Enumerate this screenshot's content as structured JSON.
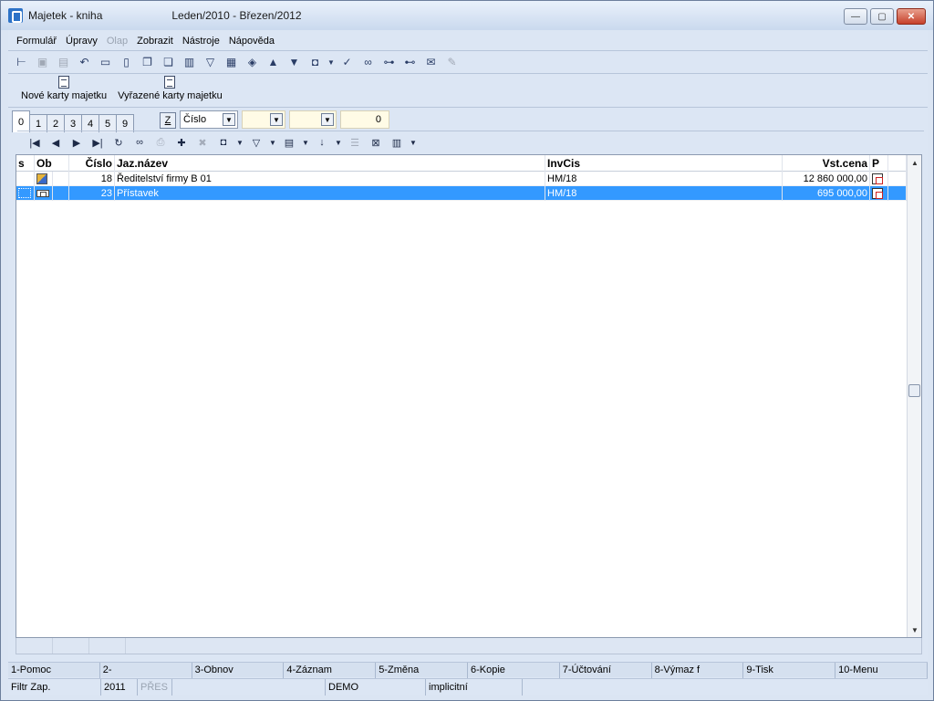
{
  "window": {
    "title": "Majetek - kniha",
    "period": "Leden/2010 - Březen/2012",
    "controls": {
      "minimize": "—",
      "maximize": "▢",
      "close": "✕"
    }
  },
  "menu": [
    "Formulář",
    "Úpravy",
    "Olap",
    "Zobrazit",
    "Nástroje",
    "Nápověda"
  ],
  "menu_disabled": [
    "Olap"
  ],
  "toolbar_icons": [
    "tree-icon",
    "save-icon",
    "save-as-icon",
    "undo-icon",
    "open-folder-icon",
    "new-document-icon",
    "copy-icon",
    "paste-icon",
    "book-icon",
    "filter-icon",
    "report-icon",
    "stack-icon",
    "arrow-up-icon",
    "arrow-down-icon",
    "camera-icon",
    "dropdown-arrow-icon",
    "checkmark-icon",
    "binoculars-icon",
    "find-next-icon",
    "find-prev-icon",
    "mail-icon",
    "edit-disabled-icon"
  ],
  "big_buttons": {
    "new_cards": "Nové karty majetku",
    "retired_cards": "Vyřazené karty majetku"
  },
  "tabs": [
    "0",
    "1",
    "2",
    "3",
    "4",
    "5",
    "9"
  ],
  "z_button": "Z",
  "sort_combo": "Číslo",
  "count_box": "0",
  "grid": {
    "headers": {
      "s": "s",
      "ob": "Ob",
      "cislo": "Číslo",
      "nazev": "Jaz.název",
      "invcis": "InvCis",
      "cena": "Vst.cena",
      "p": "P"
    },
    "rows": [
      {
        "cislo": "18",
        "nazev": "Ředitelství firmy B 01",
        "invcis": "HM/18",
        "cena": "12 860 000,00",
        "ob_icon": "building-icon"
      },
      {
        "cislo": "23",
        "nazev": "Přístavek",
        "invcis": "HM/18",
        "cena": "695 000,00",
        "ob_icon": "annex-icon"
      }
    ]
  },
  "fkeys": [
    "1-Pomoc",
    "2-",
    "3-Obnov",
    "4-Záznam",
    "5-Změna",
    "6-Kopie",
    "7-Účtování",
    "8-Výmaz f",
    "9-Tisk",
    "10-Menu"
  ],
  "status": {
    "filter": "Filtr Zap.",
    "year": "2011",
    "mode": "PŘES",
    "db": "DEMO",
    "profile": "implicitní"
  }
}
